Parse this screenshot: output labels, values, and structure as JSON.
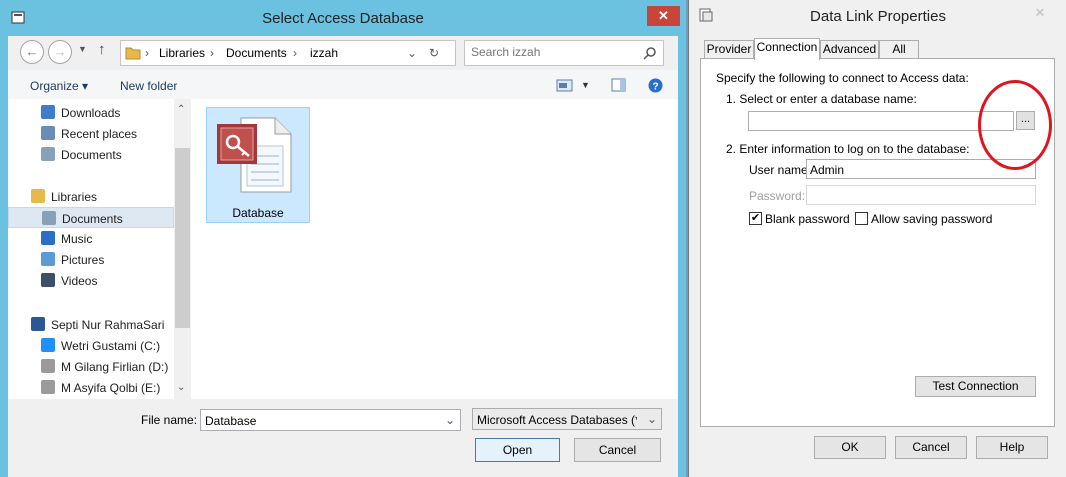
{
  "select_dialog": {
    "title": "Select Access Database",
    "close_glyph": "✕",
    "breadcrumb": [
      "Libraries",
      "Documents",
      "izzah"
    ],
    "search_placeholder": "Search izzah",
    "toolbar": {
      "organize": "Organize ▾",
      "new_folder": "New folder"
    },
    "nav_items": [
      {
        "label": "Downloads",
        "icon": "downloads-icon"
      },
      {
        "label": "Recent places",
        "icon": "recent-places-icon"
      },
      {
        "label": "Documents",
        "icon": "documents-icon"
      },
      {
        "label": "Libraries",
        "icon": "libraries-icon"
      },
      {
        "label": "Documents",
        "icon": "documents-icon",
        "selected": true
      },
      {
        "label": "Music",
        "icon": "music-icon"
      },
      {
        "label": "Pictures",
        "icon": "pictures-icon"
      },
      {
        "label": "Videos",
        "icon": "videos-icon"
      },
      {
        "label": "Septi Nur RahmaSari",
        "icon": "computer-icon"
      },
      {
        "label": "Wetri Gustami (C:)",
        "icon": "windows-drive-icon"
      },
      {
        "label": "M Gilang Firlian (D:)",
        "icon": "drive-icon"
      },
      {
        "label": "M Asyifa Qolbi (E:)",
        "icon": "drive-icon"
      }
    ],
    "files": [
      {
        "label": "Database",
        "icon": "access-database-icon"
      }
    ],
    "file_name_label": "File name:",
    "file_name_value": "Database",
    "file_type_value": "Microsoft Access Databases (*.r",
    "open_label": "Open",
    "cancel_label": "Cancel"
  },
  "data_link_dialog": {
    "title": "Data Link Properties",
    "close_glyph": "✕",
    "tabs": [
      "Provider",
      "Connection",
      "Advanced",
      "All"
    ],
    "active_tab": "Connection",
    "intro": "Specify the following to connect to Access data:",
    "step1": "1. Select or enter a database name:",
    "database_name_value": "",
    "browse_label": "...",
    "step2": "2. Enter information to log on to the database:",
    "user_name_label": "User name:",
    "user_name_value": "Admin",
    "password_label": "Password:",
    "password_value": "",
    "blank_password_label": "Blank password",
    "blank_password_checked": true,
    "allow_saving_label": "Allow saving password",
    "allow_saving_checked": false,
    "test_connection_label": "Test Connection",
    "ok_label": "OK",
    "cancel_label": "Cancel",
    "help_label": "Help"
  },
  "colors": {
    "title_bar": "#6bc1e0",
    "close_button": "#c7463a",
    "annotation_ring": "#e0141e",
    "selection": "#cce8ff"
  }
}
